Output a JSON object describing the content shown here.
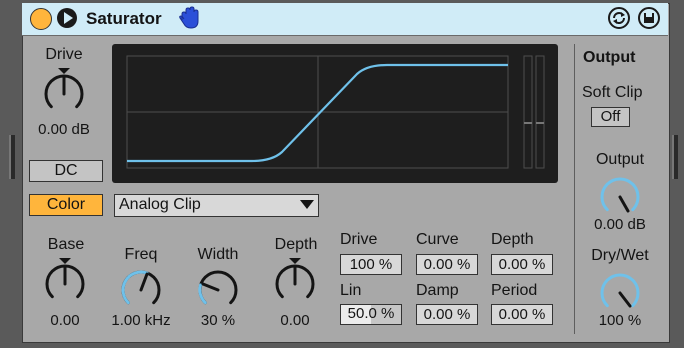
{
  "device": {
    "title": "Saturator",
    "icons": {
      "power": "power-toggle-icon",
      "fold": "play-fold-icon",
      "hand": "hand-icon",
      "hot_swap": "hot-swap-icon",
      "save": "save-preset-icon"
    },
    "colors": {
      "title_bg": "#d0ecf7",
      "body_bg": "#a8a8a8",
      "accent": "#ffb53c",
      "knob_arc": "#6fc1ea",
      "curve": "#6fc1ea",
      "graph_bg": "#1e1e1e"
    }
  },
  "drive": {
    "label": "Drive",
    "value": "0.00 dB"
  },
  "dc_button": {
    "label": "DC"
  },
  "color_button": {
    "label": "Color",
    "active": true
  },
  "type_select": {
    "value": "Analog Clip"
  },
  "graph": {
    "description": "saturation transfer curve"
  },
  "color_section": {
    "base": {
      "label": "Base",
      "value": "0.00"
    },
    "freq": {
      "label": "Freq",
      "value": "1.00 kHz"
    },
    "width": {
      "label": "Width",
      "value": "30 %"
    },
    "depth": {
      "label": "Depth",
      "value": "0.00"
    }
  },
  "waveshaper": {
    "drive": {
      "label": "Drive",
      "value": "100 %"
    },
    "curve": {
      "label": "Curve",
      "value": "0.00 %"
    },
    "depth": {
      "label": "Depth",
      "value": "0.00 %"
    },
    "lin": {
      "label": "Lin",
      "value": "50.0 %",
      "fill": 0.5
    },
    "damp": {
      "label": "Damp",
      "value": "0.00 %"
    },
    "period": {
      "label": "Period",
      "value": "0.00 %"
    }
  },
  "output_section": {
    "heading": "Output",
    "soft_clip": {
      "label": "Soft Clip",
      "value": "Off"
    },
    "output": {
      "label": "Output",
      "value": "0.00 dB"
    },
    "dry_wet": {
      "label": "Dry/Wet",
      "value": "100 %",
      "level": 1.0
    }
  }
}
